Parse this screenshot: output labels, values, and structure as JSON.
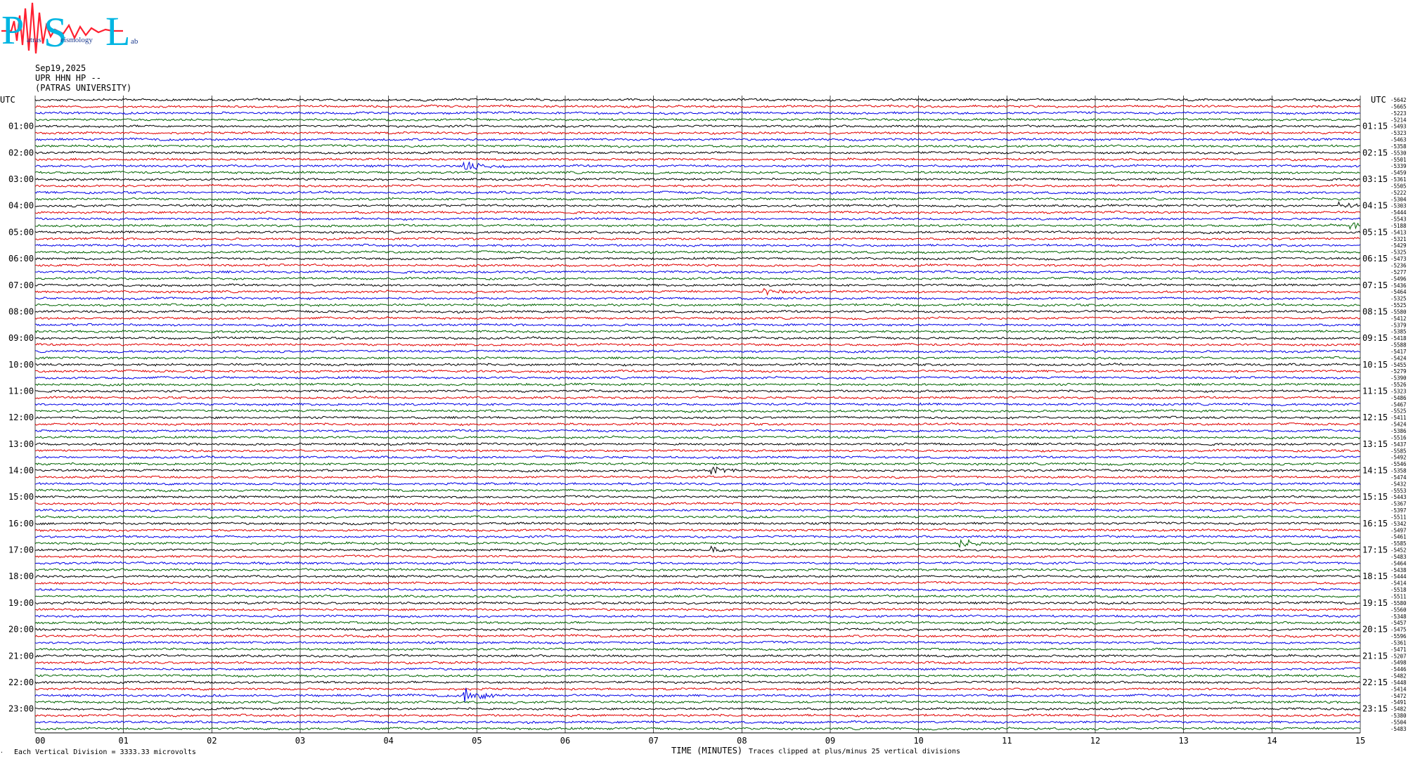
{
  "logo": {
    "letters": [
      "P",
      "S",
      "L"
    ],
    "words": [
      "atras",
      "eismology",
      "ab"
    ]
  },
  "header": {
    "date": "Sep19,2025",
    "station": "UPR HHN HP --",
    "institution": "(PATRAS UNIVERSITY)"
  },
  "chart_data": {
    "type": "line",
    "left_utc_label": "UTC",
    "right_utc_label": "UTC",
    "xlabel": "TIME (MINUTES)",
    "xticks": [
      "00",
      "01",
      "02",
      "03",
      "04",
      "05",
      "06",
      "07",
      "08",
      "09",
      "10",
      "11",
      "12",
      "13",
      "14",
      "15"
    ],
    "xlim": [
      0,
      15
    ],
    "trace_count": 96,
    "trace_minutes": 15,
    "trace_colors": [
      "#000000",
      "#e00000",
      "#0000e6",
      "#006400"
    ],
    "left_hour_labels": [
      "01:00",
      "02:00",
      "03:00",
      "04:00",
      "05:00",
      "06:00",
      "07:00",
      "08:00",
      "09:00",
      "10:00",
      "11:00",
      "12:00",
      "13:00",
      "14:00",
      "15:00",
      "16:00",
      "17:00",
      "18:00",
      "19:00",
      "20:00",
      "21:00",
      "22:00",
      "23:00"
    ],
    "right_hour_labels": [
      "01:15",
      "02:15",
      "03:15",
      "04:15",
      "05:15",
      "06:15",
      "07:15",
      "08:15",
      "09:15",
      "10:15",
      "11:15",
      "12:15",
      "13:15",
      "14:15",
      "15:15",
      "16:15",
      "17:15",
      "18:15",
      "19:15",
      "20:15",
      "21:15",
      "22:15",
      "23:15"
    ],
    "trace_offsets": [
      "-5642",
      "-5665",
      "-5223",
      "-5214",
      "-5493",
      "-5323",
      "-5463",
      "-5358",
      "-5530",
      "-5501",
      "-5339",
      "-5459",
      "-5361",
      "-5505",
      "-5222",
      "-5304",
      "-5303",
      "-5444",
      "-5543",
      "-5188",
      "-5413",
      "-5321",
      "-5429",
      "-5325",
      "-5473",
      "-5236",
      "-5277",
      "-5496",
      "-5436",
      "-5464",
      "-5325",
      "-5525",
      "-5580",
      "-5412",
      "-5379",
      "-5385",
      "-5418",
      "-5588",
      "-5417",
      "-5424",
      "-5455",
      "-5279",
      "-5390",
      "-5526",
      "-5323",
      "-5486",
      "-5467",
      "-5525",
      "-5411",
      "-5424",
      "-5386",
      "-5516",
      "-5437",
      "-5585",
      "-5492",
      "-5546",
      "-5358",
      "-5474",
      "-5432",
      "-5553",
      "-5443",
      "-5367",
      "-5397",
      "-5511",
      "-5342",
      "-5497",
      "-5461",
      "-5585",
      "-5452",
      "-5483",
      "-5464",
      "-5438",
      "-5444",
      "-5414",
      "-5518",
      "-5511",
      "-5580",
      "-5560",
      "-5348",
      "-5457",
      "-5475",
      "-5596",
      "-5361",
      "-5471",
      "-5207",
      "-5498",
      "-5446",
      "-5482",
      "-5448",
      "-5414",
      "-5472",
      "-5491",
      "-5482",
      "-5380",
      "-5504",
      "-5483"
    ],
    "events": [
      {
        "trace": 10,
        "minute": 4.9,
        "strength": 2.0
      },
      {
        "trace": 16,
        "minute": 14.8,
        "strength": 1.6
      },
      {
        "trace": 19,
        "minute": 14.9,
        "strength": 1.8
      },
      {
        "trace": 29,
        "minute": 8.3,
        "strength": 1.8
      },
      {
        "trace": 56,
        "minute": 7.7,
        "strength": 1.8
      },
      {
        "trace": 67,
        "minute": 10.5,
        "strength": 2.2
      },
      {
        "trace": 68,
        "minute": 7.7,
        "strength": 1.5
      },
      {
        "trace": 90,
        "minute": 4.9,
        "strength": 4.0
      }
    ]
  },
  "footer": {
    "vertical_division": "Each Vertical Division = 3333.33 microvolts",
    "clip_note": "Traces clipped at plus/minus 25 vertical divisions"
  }
}
